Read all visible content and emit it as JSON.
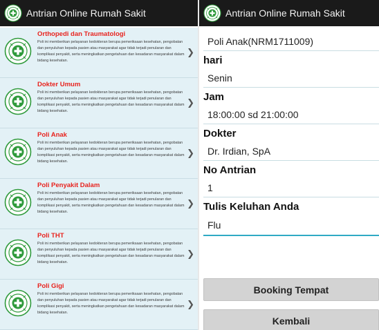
{
  "app": {
    "title": "Antrian Online Rumah Sakit"
  },
  "colors": {
    "appbar": "#1a1a1a",
    "list_bg": "#e3f1f6",
    "item_title": "#e8231e",
    "accent": "#2fa9c4",
    "logo_green": "#2f9a3b"
  },
  "poli_list": {
    "description": "Poli ini memberikan pelayanan kedokteran berupa pemeriksaan kesehatan, pengobatan dan penyuluhan kepada pasien atau masyarakat agar tidak terjadi penularan dan komplikasi penyakit, serta meningkatkan pengetahuan dan kesadaran masyarakat dalam bidang kesehatan.",
    "items": [
      {
        "title": "Orthopedi dan Traumatologi"
      },
      {
        "title": "Dokter Umum"
      },
      {
        "title": "Poli Anak"
      },
      {
        "title": "Poli Penyakit Dalam"
      },
      {
        "title": "Poli THT"
      },
      {
        "title": "Poli Gigi"
      }
    ]
  },
  "form": {
    "poli_value": "Poli Anak(NRM1711009)",
    "hari_label": "hari",
    "hari_value": "Senin",
    "jam_label": "Jam",
    "jam_value": "18:00:00 sd 21:00:00",
    "dokter_label": "Dokter",
    "dokter_value": "Dr. Irdian, SpA",
    "antrian_label": "No Antrian",
    "antrian_value": "1",
    "keluhan_label": "Tulis Keluhan Anda",
    "keluhan_value": "Flu",
    "booking_button": "Booking Tempat",
    "kembali_button": "Kembali"
  }
}
